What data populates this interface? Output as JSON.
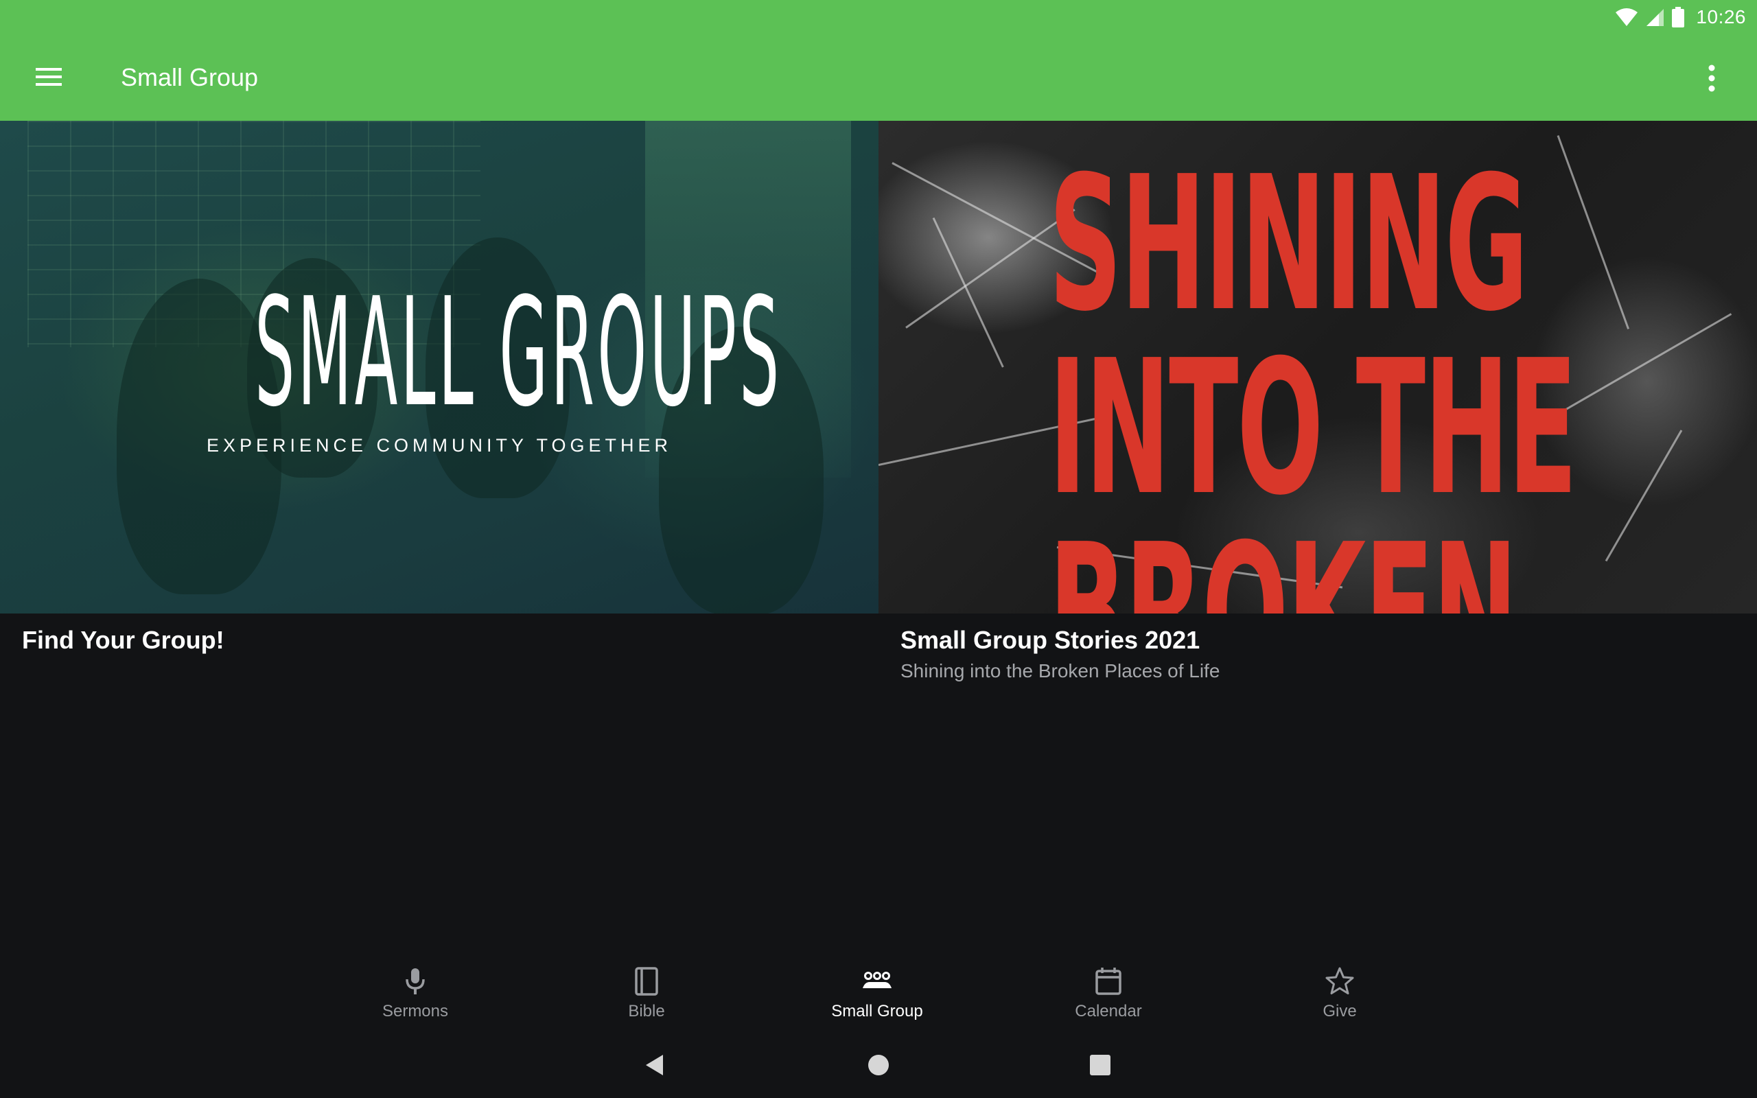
{
  "status_bar": {
    "time": "10:26",
    "icons": [
      "wifi-icon",
      "cell-signal-icon",
      "battery-icon"
    ]
  },
  "app_bar": {
    "title": "Small Group",
    "menu_icon": "hamburger-menu-icon",
    "overflow_icon": "more-vert-icon"
  },
  "cards": [
    {
      "banner": {
        "headline": "SMALL GROUPS",
        "tagline": "EXPERIENCE COMMUNITY TOGETHER"
      },
      "title": "Find Your Group!",
      "subtitle": ""
    },
    {
      "banner": {
        "headline_lines": [
          "SHINING",
          "INTO THE",
          "BROKEN"
        ]
      },
      "title": "Small Group Stories 2021",
      "subtitle": "Shining into the Broken Places of Life"
    }
  ],
  "bottom_nav": {
    "items": [
      {
        "label": "Sermons",
        "icon": "microphone-icon",
        "active": false
      },
      {
        "label": "Bible",
        "icon": "book-icon",
        "active": false
      },
      {
        "label": "Small Group",
        "icon": "group-icon",
        "active": true
      },
      {
        "label": "Calendar",
        "icon": "calendar-icon",
        "active": false
      },
      {
        "label": "Give",
        "icon": "star-icon",
        "active": false
      }
    ]
  },
  "system_nav": {
    "icons": [
      "back-icon",
      "home-icon",
      "recents-icon"
    ]
  },
  "colors": {
    "primary": "#5cc155",
    "background": "#121315",
    "text_primary": "#ffffff",
    "text_secondary": "#a6a8ac",
    "nav_inactive": "#9a9ca0",
    "banner_red": "#d9372a"
  }
}
